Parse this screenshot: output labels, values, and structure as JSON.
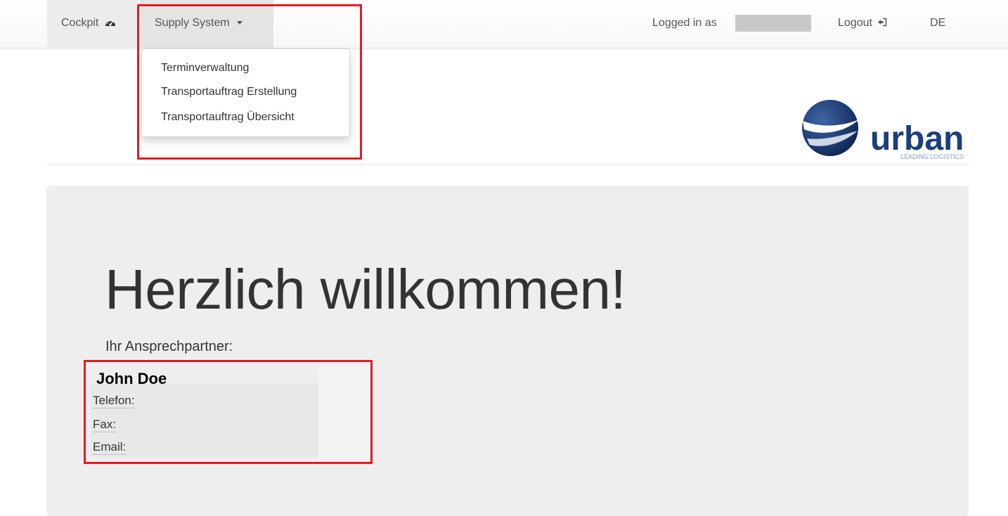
{
  "nav": {
    "cockpit": "Cockpit",
    "supply_system": "Supply System",
    "logged_in_as": "Logged in as",
    "logout": "Logout",
    "language": "DE"
  },
  "dropdown": {
    "items": [
      "Terminverwaltung",
      "Transportauftrag Erstellung",
      "Transportauftrag Übersicht"
    ]
  },
  "logo": {
    "brand": "urban",
    "tagline": "LEADING LOGISTICS",
    "color": "#1d3f7a"
  },
  "main": {
    "welcome": "Herzlich willkommen!",
    "partner_label": "Ihr Ansprechpartner:"
  },
  "contact": {
    "name": "John Doe",
    "phone_label": "Telefon:",
    "fax_label": "Fax:",
    "email_label": "Email:"
  },
  "highlight_color": "#e11c24"
}
